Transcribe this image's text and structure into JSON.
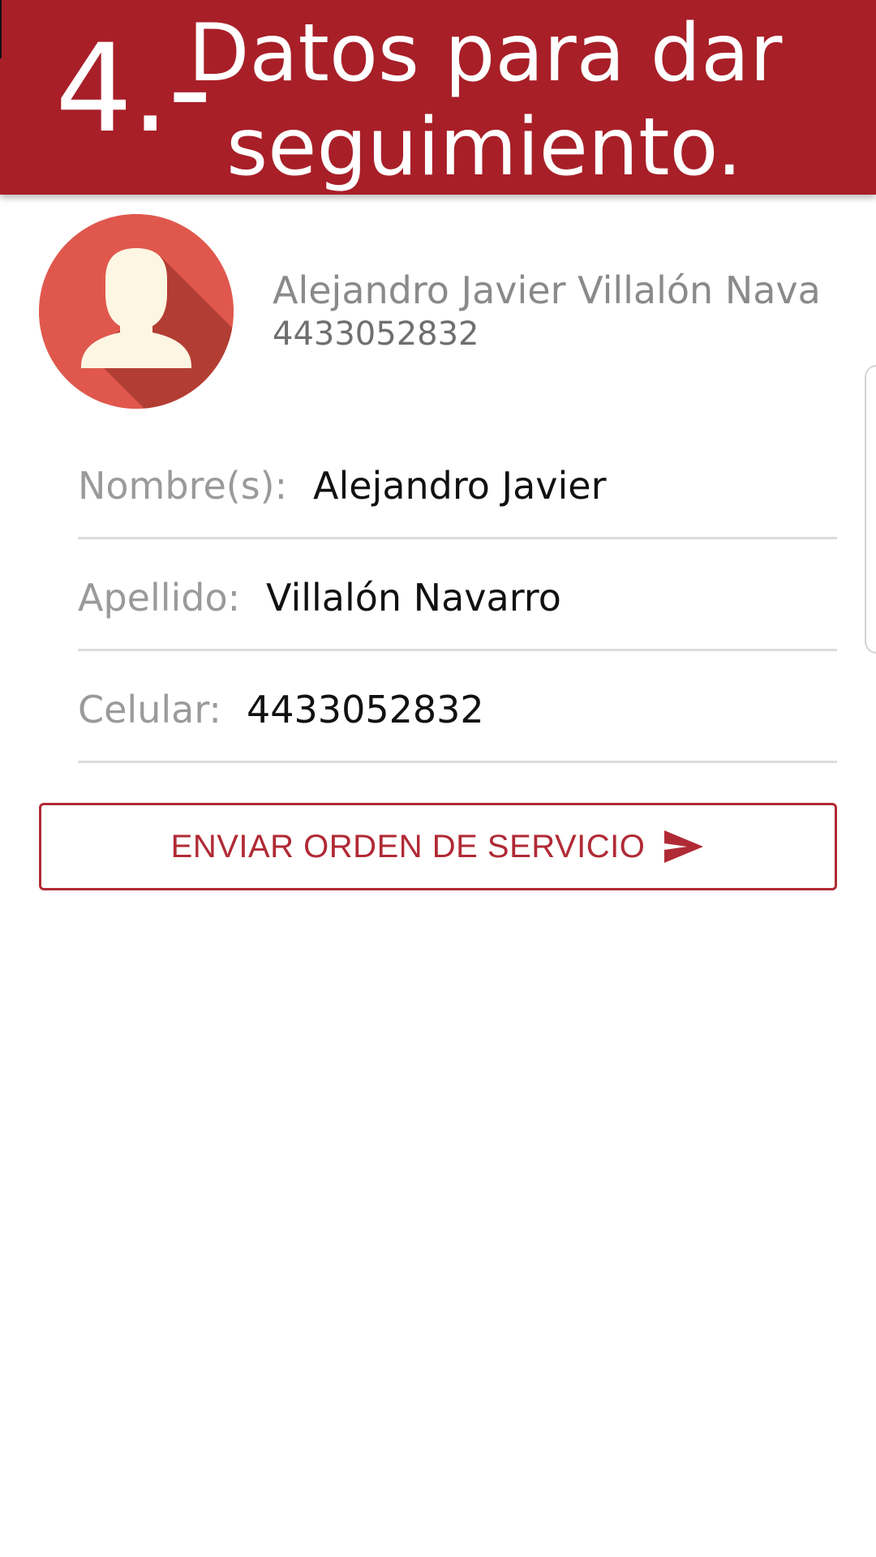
{
  "header": {
    "step_number": "4.-",
    "title_line1": "Datos para dar",
    "title_line2": "seguimiento.",
    "background_color": "#a81f28"
  },
  "profile": {
    "avatar_icon": "user-avatar-icon",
    "full_name": "Alejandro Javier Villalón Navarro",
    "phone": "4433052832"
  },
  "fields": {
    "nombre": {
      "label": "Nombre(s):",
      "value": "Alejandro Javier"
    },
    "apellido": {
      "label": "Apellido:",
      "value": "Villalón Navarro"
    },
    "celular": {
      "label": "Celular:",
      "value": "4433052832"
    }
  },
  "send_button": {
    "label": "ENVIAR ORDEN DE SERVICIO",
    "icon": "send-icon",
    "color": "#b02a35"
  }
}
